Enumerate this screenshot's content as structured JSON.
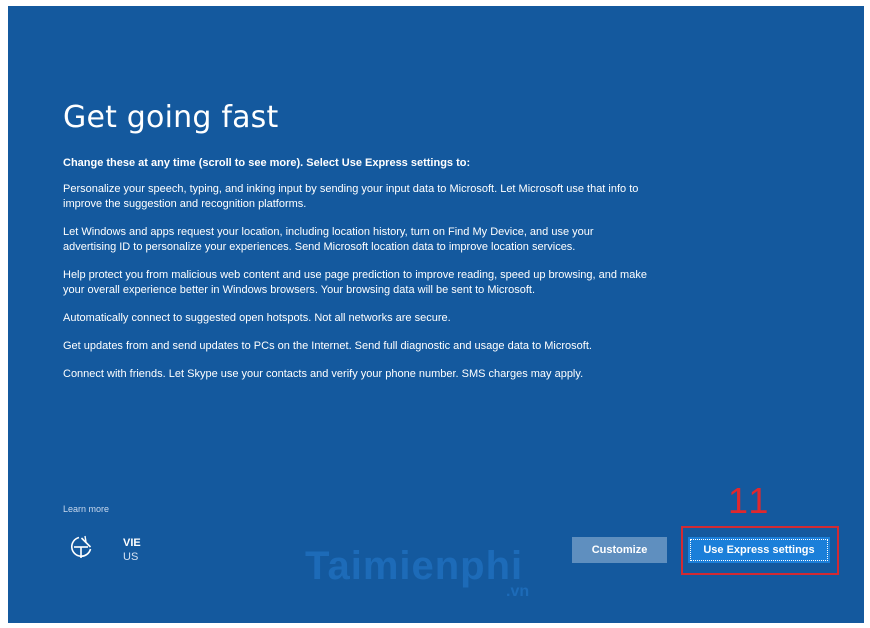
{
  "title": "Get going fast",
  "lead": "Change these at any time (scroll to see more). Select Use Express settings to:",
  "paragraphs": [
    "Personalize your speech, typing, and inking input by sending your input data to Microsoft. Let Microsoft use that info to improve the suggestion and recognition platforms.",
    "Let Windows and apps request your location, including location history, turn on Find My Device, and use your advertising ID to personalize your experiences. Send Microsoft location data to improve location services.",
    "Help protect you from malicious web content and use page prediction to improve reading, speed up browsing, and make your overall experience better in Windows browsers. Your browsing data will be sent to Microsoft.",
    "Automatically connect to suggested open hotspots. Not all networks are secure.",
    "Get updates from and send updates to PCs on the Internet. Send full diagnostic and usage data to Microsoft.",
    "Connect with friends. Let Skype use your contacts and verify your phone number. SMS charges may apply."
  ],
  "learn_more": "Learn more",
  "language": {
    "code": "VIE",
    "region": "US"
  },
  "buttons": {
    "customize": "Customize",
    "express": "Use Express settings"
  },
  "annotation": {
    "step_number": "11"
  },
  "watermark": {
    "brand": "Taimienphi",
    "tld": ".vn"
  },
  "icons": {
    "accessibility": "ease-of-access-icon"
  },
  "colors": {
    "background": "#14599e",
    "primary_button": "#1b7fd9",
    "secondary_button": "#5f8fbf",
    "highlight": "#d32a32"
  }
}
